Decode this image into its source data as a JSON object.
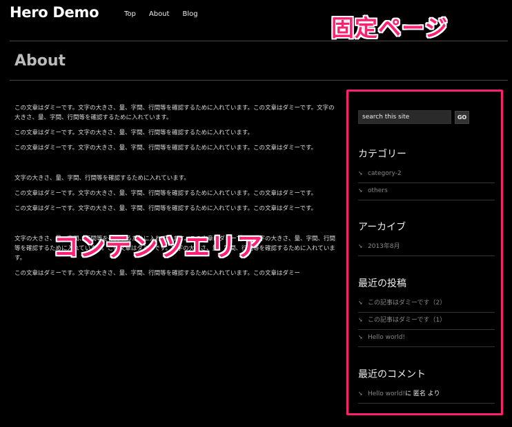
{
  "header": {
    "site_title": "Hero Demo",
    "nav": [
      {
        "label": "Top"
      },
      {
        "label": "About"
      },
      {
        "label": "Blog"
      }
    ]
  },
  "annotations": {
    "fixed_page": "固定ページ",
    "content_area": "コンテンツエリア"
  },
  "page": {
    "title": "About",
    "paragraphs": [
      "この文章はダミーです。文字の大きさ、量、字間、行間等を確認するために入れています。この文章はダミーです。文字の大きさ、量、字間、行間等を確認するために入れています。",
      "この文章はダミーです。文字の大きさ、量、字間、行間等を確認するために入れています。",
      "この文章はダミーです。文字の大きさ、量、字間、行間等を確認するために入れています。この文章はダミーです。",
      "文字の大きさ、量、字間、行間等を確認するために入れています。",
      "この文章はダミーです。文字の大きさ、量、字間、行間等を確認するために入れています。この文章はダミーです。",
      "この文章はダミーです。文字の大きさ、量、字間、行間等を確認するために入れています。この文章はダミーです。",
      "文字の大きさ、量、字間、行間等を確認するために入れています。この文章はダミーです。文字の大きさ、量、字間、行間等を確認するために入れています。この文章はダミーです。文字の大きさ、量、字間、行間等を確認するために入れています。",
      "この文章はダミーです。文字の大きさ、量、字間、行間等を確認するために入れています。この文章はダミー"
    ]
  },
  "sidebar": {
    "search": {
      "placeholder": "search this site",
      "button_label": "GO"
    },
    "categories": {
      "title": "カテゴリー",
      "items": [
        {
          "label": "category-2"
        },
        {
          "label": "others"
        }
      ]
    },
    "archives": {
      "title": "アーカイブ",
      "items": [
        {
          "label": "2013年8月"
        }
      ]
    },
    "recent_posts": {
      "title": "最近の投稿",
      "items": [
        {
          "label": "この記事はダミーです（2）"
        },
        {
          "label": "この記事はダミーです（1）"
        },
        {
          "label": "Hello world!"
        }
      ]
    },
    "recent_comments": {
      "title": "最近のコメント",
      "items": [
        {
          "post": "Hello world!",
          "connector": " に 匿名 より"
        }
      ]
    }
  },
  "colors": {
    "accent": "#ff1f73",
    "background": "#000000"
  },
  "icons": {
    "list_bullet": "arrow-down-right-icon"
  }
}
